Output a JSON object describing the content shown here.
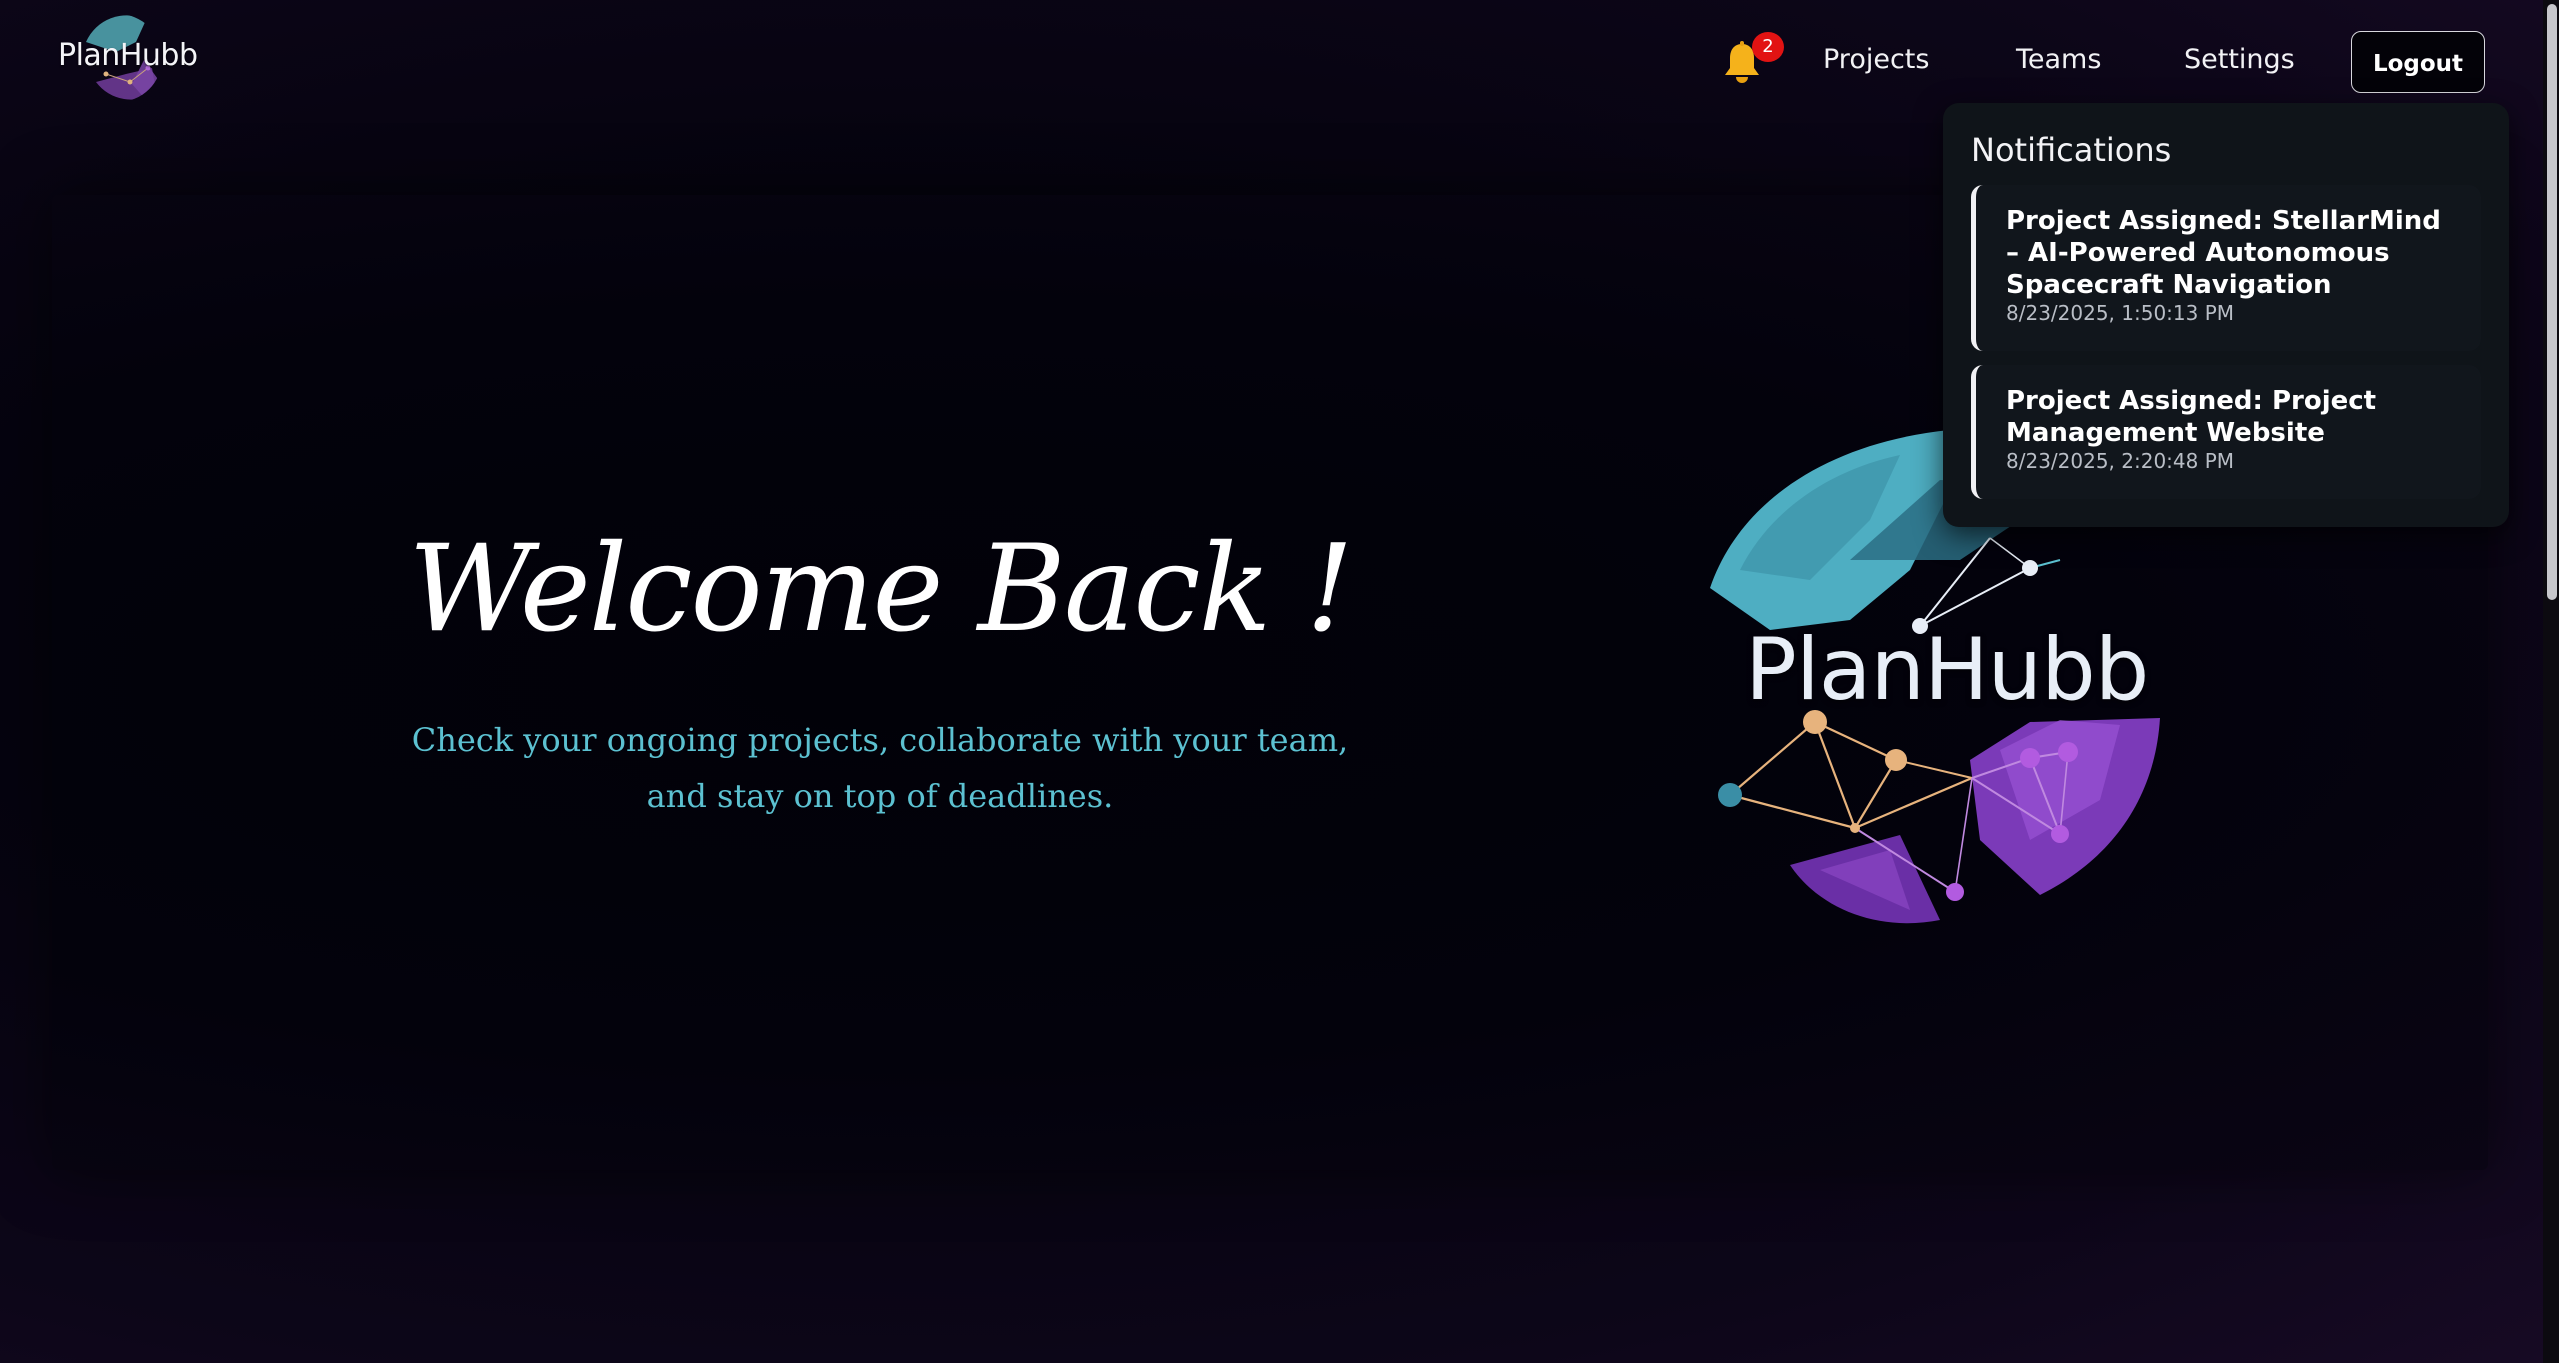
{
  "brand": {
    "name": "PlanHubb"
  },
  "nav": {
    "notifications_count": "2",
    "links": [
      "Projects",
      "Teams",
      "Settings"
    ],
    "logout_label": "Logout"
  },
  "notifications": {
    "title": "Notifications",
    "items": [
      {
        "message": "Project Assigned: StellarMind – AI-Powered Autonomous Spacecraft Navigation",
        "time": "8/23/2025, 1:50:13 PM"
      },
      {
        "message": "Project Assigned: Project Management Website",
        "time": "8/23/2025, 2:20:48 PM"
      }
    ]
  },
  "hero": {
    "heading": "Welcome Back !",
    "subtitle": "Check your ongoing projects, collaborate with your team, and stay on top of deadlines.",
    "logo_text": "PlanHubb"
  },
  "colors": {
    "accent_teal": "#5cc1d1",
    "accent_purple": "#8a3fc4",
    "accent_peach": "#e7b37d",
    "badge_red": "#e21313",
    "panel_bg": "#0f1419"
  },
  "icons": {
    "notifications": "bell-icon"
  }
}
